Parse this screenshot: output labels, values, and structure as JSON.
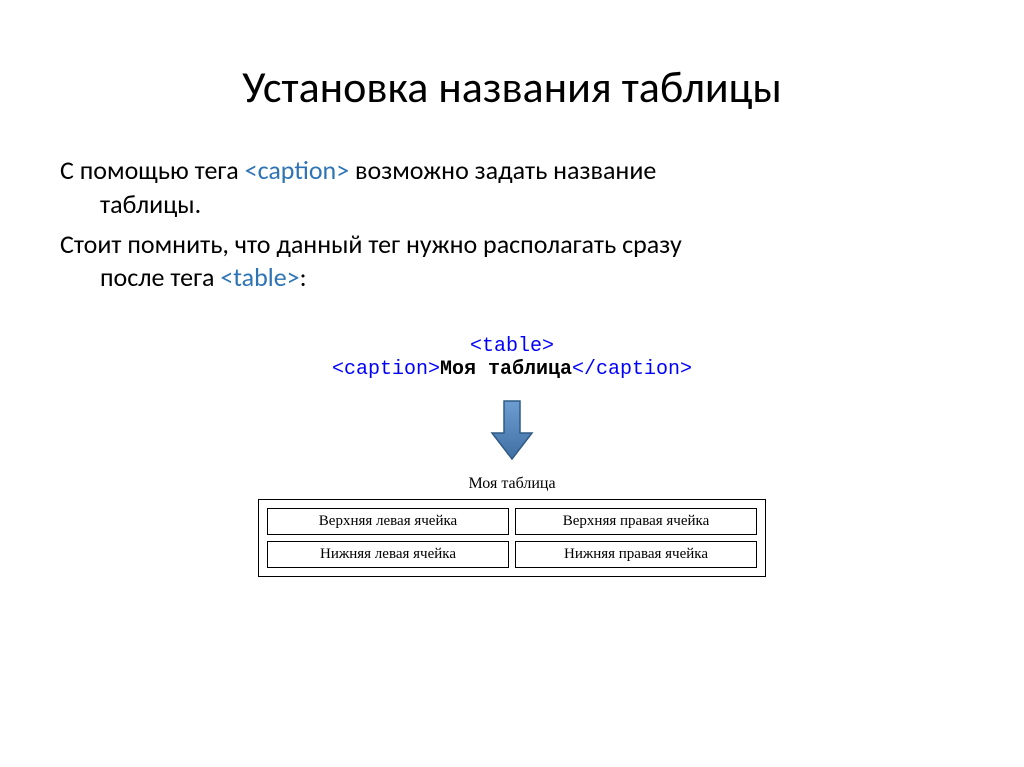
{
  "title": "Установка названия таблицы",
  "para1_a": "С помощью тега ",
  "para1_tag": "<caption>",
  "para1_b": "  возможно задать название",
  "para1_c": "таблицы.",
  "para2_a": "Стоит помнить, что данный тег нужно располагать сразу",
  "para2_b": "после тега ",
  "para2_tag": "<table>",
  "para2_c": ":",
  "code": {
    "line1": "<table>",
    "line2a": "<caption>",
    "line2b": "Моя таблица",
    "line2c": "</caption>"
  },
  "example": {
    "caption": "Моя таблица",
    "r1c1": "Верхняя левая ячейка",
    "r1c2": "Верхняя правая ячейка",
    "r2c1": "Нижняя левая ячейка",
    "r2c2": "Нижняя правая ячейка"
  }
}
